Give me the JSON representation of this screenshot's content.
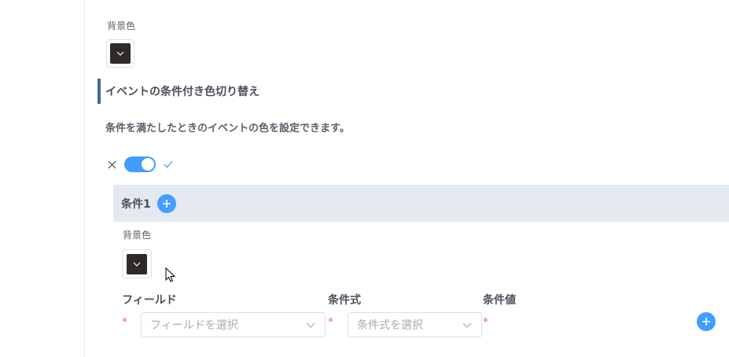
{
  "background_section": {
    "label": "背景色",
    "color": "#2d2a27"
  },
  "section": {
    "title": "イベントの条件付き色切り替え",
    "description": "条件を満たしたときのイベントの色を設定できます。"
  },
  "toggle": {
    "enabled": true,
    "off_icon": "close-icon",
    "on_icon": "check-icon"
  },
  "condition": {
    "title": "条件1",
    "background_label": "背景色",
    "background_color": "#2d2a27",
    "columns": {
      "field": "フィールド",
      "expression": "条件式",
      "value": "条件値"
    },
    "required_mark": "*",
    "field_placeholder": "フィールドを選択",
    "expression_placeholder": "条件式を選択"
  },
  "colors": {
    "accent": "#409eff",
    "section_border": "#3e6a9a",
    "header_bg": "#e4e8ef",
    "required": "#f56c6c"
  }
}
